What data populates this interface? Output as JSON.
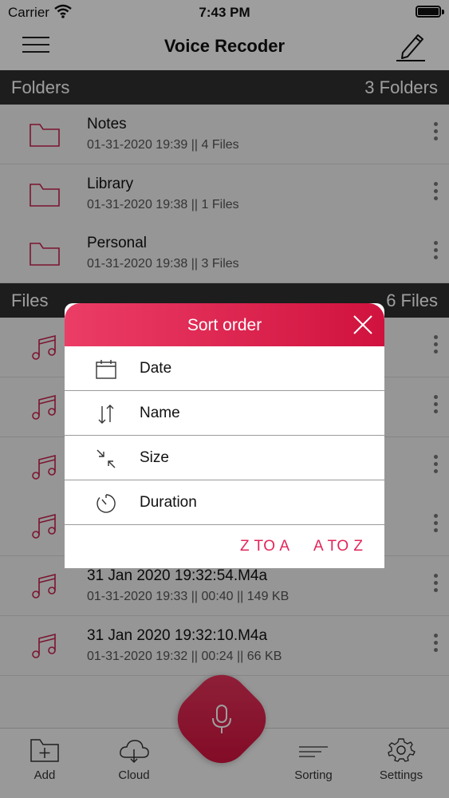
{
  "status_bar": {
    "carrier": "Carrier",
    "time": "7:43 PM"
  },
  "header": {
    "title": "Voice Recoder"
  },
  "folders_section": {
    "label": "Folders",
    "count": "3 Folders"
  },
  "folders": [
    {
      "name": "Notes",
      "meta": "01-31-2020 19:39 || 4 Files"
    },
    {
      "name": "Library",
      "meta": "01-31-2020 19:38 || 1 Files"
    },
    {
      "name": "Personal",
      "meta": "01-31-2020 19:38 || 3 Files"
    }
  ],
  "files_section": {
    "label": "Files",
    "count": "6 Files"
  },
  "files": [
    {
      "name": "",
      "meta": ""
    },
    {
      "name": "",
      "meta": ""
    },
    {
      "name": "",
      "meta": ""
    },
    {
      "name": "",
      "meta": ""
    },
    {
      "name": "31 Jan 2020 19:32:54.M4a",
      "meta": "01-31-2020 19:33 || 00:40 || 149 KB"
    },
    {
      "name": "31 Jan 2020 19:32:10.M4a",
      "meta": "01-31-2020 19:32 || 00:24 || 66 KB"
    }
  ],
  "sort_dialog": {
    "title": "Sort order",
    "options": [
      {
        "label": "Date",
        "icon": "calendar-icon"
      },
      {
        "label": "Name",
        "icon": "sort-arrows-icon"
      },
      {
        "label": "Size",
        "icon": "compress-icon"
      },
      {
        "label": "Duration",
        "icon": "timer-icon"
      }
    ],
    "z_to_a": "Z TO A",
    "a_to_z": "A TO Z"
  },
  "tabbar": {
    "add": "Add",
    "cloud": "Cloud",
    "sorting": "Sorting",
    "settings": "Settings"
  },
  "colors": {
    "accent": "#e3255a",
    "section_bg": "#2f2f2f"
  }
}
